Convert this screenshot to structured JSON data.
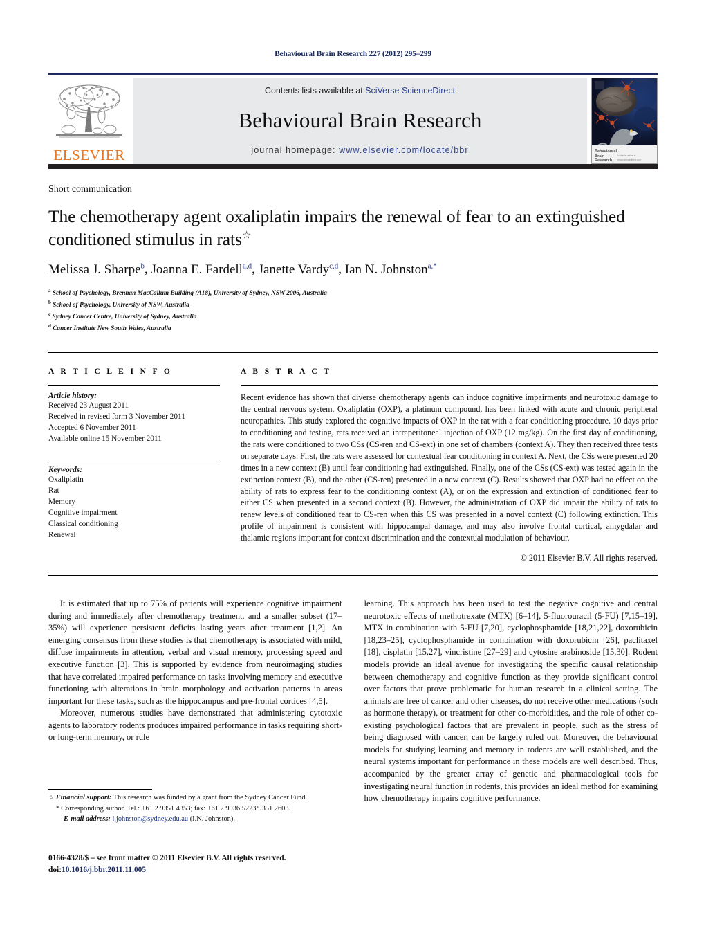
{
  "running_head": "Behavioural Brain Research 227 (2012) 295–299",
  "masthead": {
    "publisher_name": "ELSEVIER",
    "contents_prefix": "Contents lists available at ",
    "contents_link": "SciVerse ScienceDirect",
    "journal_title": "Behavioural Brain Research",
    "homepage_prefix": "journal homepage: ",
    "homepage_url": "www.elsevier.com/locate/bbr",
    "cover_title_line1": "Behavioural",
    "cover_title_line2": "Brain",
    "cover_title_line3": "Research",
    "cover_small_text": "Available online at www.sciencedirect.com"
  },
  "article": {
    "type_label": "Short communication",
    "title": "The chemotherapy agent oxaliplatin impairs the renewal of fear to an extinguished conditioned stimulus in rats",
    "title_footnote_marker": "☆",
    "authors": [
      {
        "name": "Melissa J. Sharpe",
        "sup": "b",
        "sep": ", "
      },
      {
        "name": "Joanna E. Fardell",
        "sup": "a,d",
        "sep": ", "
      },
      {
        "name": "Janette Vardy",
        "sup": "c,d",
        "sep": ", "
      },
      {
        "name": "Ian N. Johnston",
        "sup": "a,*",
        "sep": ""
      }
    ],
    "affiliations": [
      {
        "label": "a",
        "text": "School of Psychology, Brennan MacCallum Building (A18), University of Sydney, NSW 2006, Australia"
      },
      {
        "label": "b",
        "text": "School of Psychology, University of NSW, Australia"
      },
      {
        "label": "c",
        "text": "Sydney Cancer Centre, University of Sydney, Australia"
      },
      {
        "label": "d",
        "text": "Cancer Institute New South Wales, Australia"
      }
    ]
  },
  "article_info": {
    "heading": "A R T I C L E   I N F O",
    "history_title": "Article history:",
    "history": [
      "Received 23 August 2011",
      "Received in revised form 3 November 2011",
      "Accepted 6 November 2011",
      "Available online 15 November 2011"
    ],
    "keywords_title": "Keywords:",
    "keywords": [
      "Oxaliplatin",
      "Rat",
      "Memory",
      "Cognitive impairment",
      "Classical conditioning",
      "Renewal"
    ]
  },
  "abstract": {
    "heading": "A B S T R A C T",
    "text": "Recent evidence has shown that diverse chemotherapy agents can induce cognitive impairments and neurotoxic damage to the central nervous system. Oxaliplatin (OXP), a platinum compound, has been linked with acute and chronic peripheral neuropathies. This study explored the cognitive impacts of OXP in the rat with a fear conditioning procedure. 10 days prior to conditioning and testing, rats received an intraperitoneal injection of OXP (12 mg/kg). On the first day of conditioning, the rats were conditioned to two CSs (CS-ren and CS-ext) in one set of chambers (context A). They then received three tests on separate days. First, the rats were assessed for contextual fear conditioning in context A. Next, the CSs were presented 20 times in a new context (B) until fear conditioning had extinguished. Finally, one of the CSs (CS-ext) was tested again in the extinction context (B), and the other (CS-ren) presented in a new context (C). Results showed that OXP had no effect on the ability of rats to express fear to the conditioning context (A), or on the expression and extinction of conditioned fear to either CS when presented in a second context (B). However, the administration of OXP did impair the ability of rats to renew levels of conditioned fear to CS-ren when this CS was presented in a novel context (C) following extinction. This profile of impairment is consistent with hippocampal damage, and may also involve frontal cortical, amygdalar and thalamic regions important for context discrimination and the contextual modulation of behaviour.",
    "copyright": "© 2011 Elsevier B.V. All rights reserved."
  },
  "body": {
    "left_paragraphs": [
      "It is estimated that up to 75% of patients will experience cognitive impairment during and immediately after chemotherapy treatment, and a smaller subset (17–35%) will experience persistent deficits lasting years after treatment [1,2]. An emerging consensus from these studies is that chemotherapy is associated with mild, diffuse impairments in attention, verbal and visual memory, processing speed and executive function [3]. This is supported by evidence from neuroimaging studies that have correlated impaired performance on tasks involving memory and executive functioning with alterations in brain morphology and activation patterns in areas important for these tasks, such as the hippocampus and pre-frontal cortices [4,5].",
      "Moreover, numerous studies have demonstrated that administering cytotoxic agents to laboratory rodents produces impaired performance in tasks requiring short- or long-term memory, or rule"
    ],
    "right_paragraphs": [
      "learning. This approach has been used to test the negative cognitive and central neurotoxic effects of methotrexate (MTX) [6–14], 5-fluorouracil (5-FU) [7,15–19], MTX in combination with 5-FU [7,20], cyclophosphamide [18,21,22], doxorubicin [18,23–25], cyclophosphamide in combination with doxorubicin [26], paclitaxel [18], cisplatin [15,27], vincristine [27–29] and cytosine arabinoside [15,30]. Rodent models provide an ideal avenue for investigating the specific causal relationship between chemotherapy and cognitive function as they provide significant control over factors that prove problematic for human research in a clinical setting. The animals are free of cancer and other diseases, do not receive other medications (such as hormone therapy), or treatment for other co-morbidities, and the role of other co-existing psychological factors that are prevalent in people, such as the stress of being diagnosed with cancer, can be largely ruled out. Moreover, the behavioural models for studying learning and memory in rodents are well established, and the neural systems important for performance in these models are well described. Thus, accompanied by the greater array of genetic and pharmacological tools for investigating neural function in rodents, this provides an ideal method for examining how chemotherapy impairs cognitive performance."
    ]
  },
  "footnotes": {
    "financial_marker": "☆",
    "financial_label": "Financial support:",
    "financial_text": " This research was funded by a grant from the Sydney Cancer Fund.",
    "corr_marker": "*",
    "corr_text": "Corresponding author. Tel.: +61 2 9351 4353; fax: +61 2 9036 5223/9351 2603.",
    "email_label": "E-mail address:",
    "email": "i.johnston@sydney.edu.au",
    "email_owner": "(I.N. Johnston)."
  },
  "imprint": {
    "issn_line": "0166-4328/$ – see front matter © 2011 Elsevier B.V. All rights reserved.",
    "doi_prefix": "doi:",
    "doi": "10.1016/j.bbr.2011.11.005"
  },
  "colors": {
    "link_blue": "#2b3f8c",
    "navy": "#1b2c63",
    "elsevier_orange": "#E87722",
    "band_gray": "#e8e9eb",
    "dark_band": "#231f20"
  }
}
